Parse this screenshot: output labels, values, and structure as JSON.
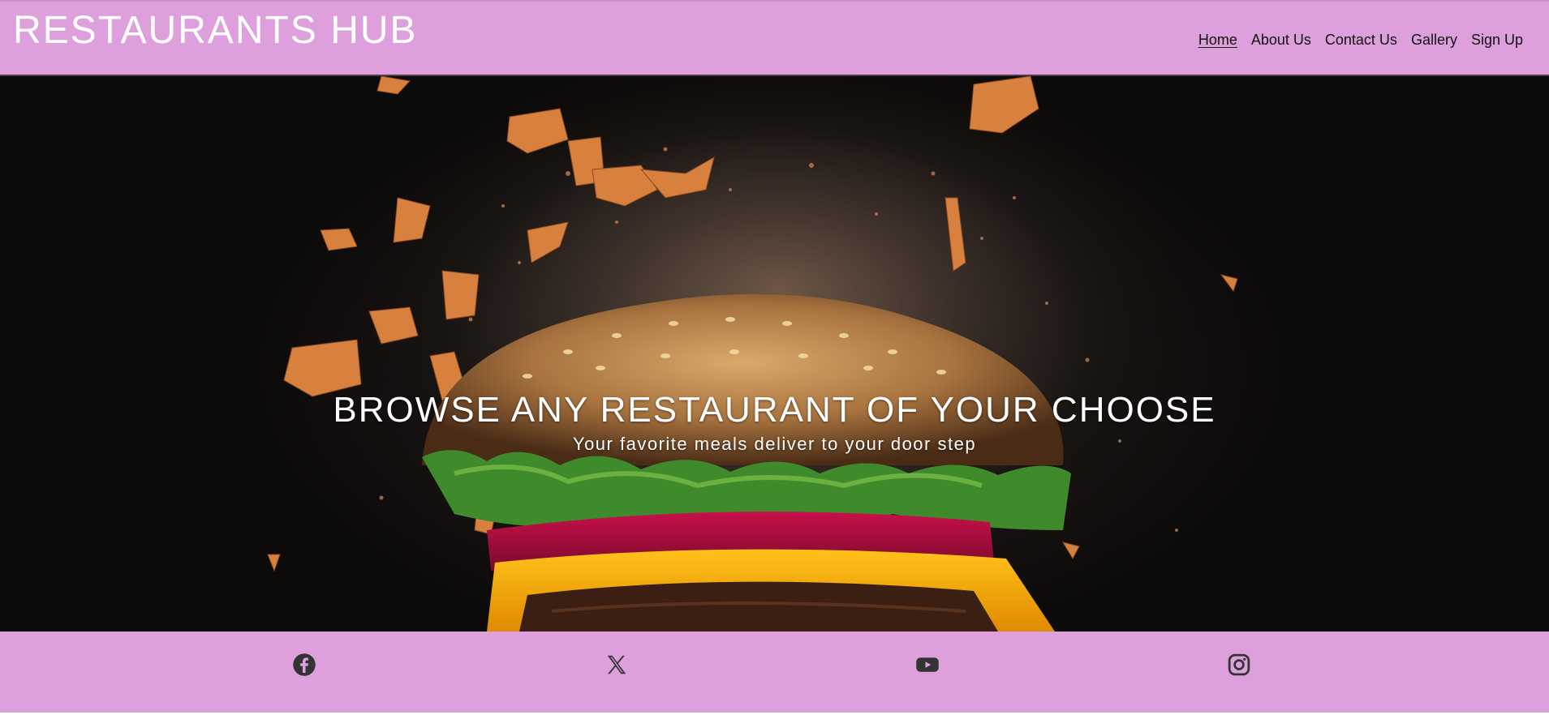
{
  "header": {
    "brand": "RESTAURANTS HUB",
    "nav": [
      {
        "label": "Home",
        "active": true
      },
      {
        "label": "About Us",
        "active": false
      },
      {
        "label": "Contact Us",
        "active": false
      },
      {
        "label": "Gallery",
        "active": false
      },
      {
        "label": "Sign Up",
        "active": false
      }
    ]
  },
  "hero": {
    "heading": "BROWSE ANY RESTAURANT OF YOUR CHOOSE",
    "subheading": "Your favorite meals deliver to your door step",
    "image": "burger-photo"
  },
  "footer": {
    "social": [
      {
        "icon": "facebook-icon"
      },
      {
        "icon": "x-twitter-icon"
      },
      {
        "icon": "youtube-icon"
      },
      {
        "icon": "instagram-icon"
      }
    ]
  },
  "colors": {
    "header_bg": "#dda0dd",
    "footer_bg": "#dda0dd",
    "brand_text": "#ffffff",
    "nav_text": "#111111",
    "icon_color": "#333333"
  }
}
